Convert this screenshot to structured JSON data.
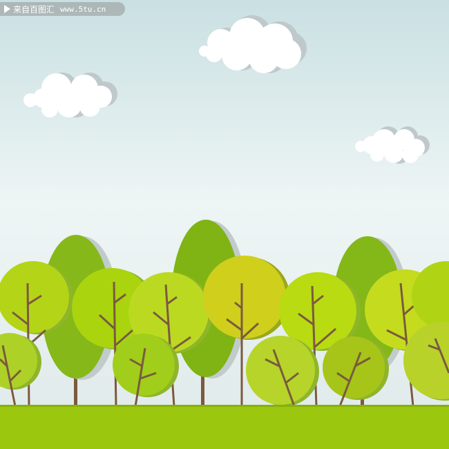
{
  "watermark": {
    "label": "来自百图汇",
    "url": "www.5tu.cn"
  },
  "palette": {
    "sky_top": "#c9e0e2",
    "sky_bottom": "#f4f8f8",
    "grass": "#9bc80e",
    "trunk": "#7b5a3e",
    "tall_tree": "#85b718",
    "cloud": "#ffffff",
    "cloud_shadow": "#bcc8cc"
  },
  "scene": {
    "clouds": [
      "cloud",
      "cloud",
      "cloud"
    ],
    "tall_trees": [
      {
        "color": "#86b81a"
      },
      {
        "color": "#7fb414"
      },
      {
        "color": "#84b718"
      }
    ],
    "back_round_trees": [
      {
        "color": "#b4d418"
      },
      {
        "color": "#a9d40e"
      },
      {
        "color": "#bcd922"
      },
      {
        "color": "#d0cf1c"
      },
      {
        "color": "#b8db12"
      },
      {
        "color": "#c4db1e"
      },
      {
        "color": "#b0d414"
      }
    ],
    "front_round_trees": [
      {
        "color": "#aed128"
      },
      {
        "color": "#a0ce1a"
      },
      {
        "color": "#b6d42a"
      },
      {
        "color": "#a6c518"
      },
      {
        "color": "#b8d22a"
      }
    ]
  }
}
